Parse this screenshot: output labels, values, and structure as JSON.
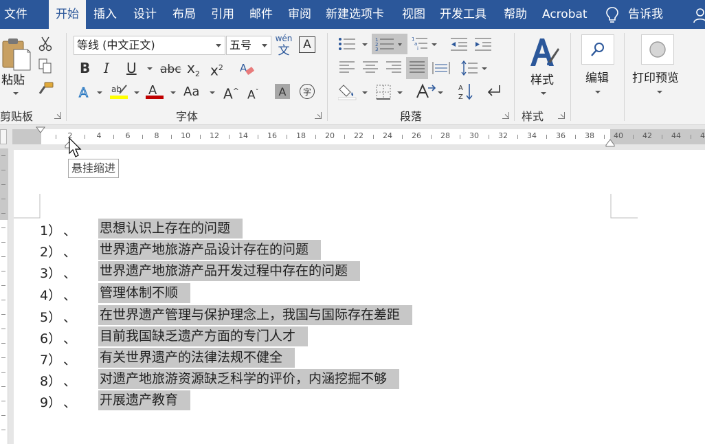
{
  "menu": {
    "tabs": [
      "文件",
      "开始",
      "插入",
      "设计",
      "布局",
      "引用",
      "邮件",
      "审阅",
      "新建选项卡",
      "视图",
      "开发工具",
      "帮助",
      "Acrobat"
    ],
    "active_index": 1,
    "tell_me": "告诉我"
  },
  "ribbon": {
    "clipboard": {
      "paste": "粘贴",
      "label": "剪贴板"
    },
    "font": {
      "font_name": "等线 (中文正文)",
      "font_size": "五号",
      "phonetic_top": "wén",
      "phonetic_bottom": "文",
      "border_char": "A",
      "bold": "B",
      "italic": "I",
      "underline": "U",
      "strike": "abc",
      "subscript": "x",
      "subscript_mark": "2",
      "superscript": "x",
      "superscript_mark": "2",
      "change_case": "Aa",
      "grow": "A",
      "shrink": "A",
      "shade_char": "A",
      "enclose_char": "字",
      "label": "字体"
    },
    "paragraph": {
      "label": "段落"
    },
    "styles": {
      "big": "样式",
      "label": "样式"
    },
    "editing": {
      "big": "编辑"
    },
    "print_preview": {
      "big": "打印预览"
    },
    "colors": {
      "tab_bar": "#2b579a",
      "highlight": "#ffff00",
      "font_color": "#c00000",
      "selection": "#c7c7c7"
    }
  },
  "ruler": {
    "labels": [
      "2",
      "4",
      "6",
      "8",
      "10",
      "12",
      "14",
      "16",
      "18",
      "20",
      "22",
      "24",
      "26",
      "28",
      "30",
      "32",
      "34",
      "36",
      "38",
      "40",
      "42",
      "44",
      "46"
    ]
  },
  "tooltip": "悬挂缩进",
  "list_items": [
    {
      "num": "1）",
      "sep": "、",
      "text": "思想认识上存在的问题"
    },
    {
      "num": "2）",
      "sep": "、",
      "text": "世界遗产地旅游产品设计存在的问题"
    },
    {
      "num": "3）",
      "sep": "、",
      "text": "世界遗产地旅游产品开发过程中存在的问题"
    },
    {
      "num": "4）",
      "sep": "、",
      "text": "管理体制不顺"
    },
    {
      "num": "5）",
      "sep": "、",
      "text": "在世界遗产管理与保护理念上，我国与国际存在差距"
    },
    {
      "num": "6）",
      "sep": "、",
      "text": "目前我国缺乏遗产方面的专门人才"
    },
    {
      "num": "7）",
      "sep": "、",
      "text": "有关世界遗产的法律法规不健全"
    },
    {
      "num": "8）",
      "sep": "、",
      "text": "对遗产地旅游资源缺乏科学的评价，内涵挖掘不够"
    },
    {
      "num": "9）",
      "sep": "、",
      "text": "开展遗产教育"
    }
  ]
}
